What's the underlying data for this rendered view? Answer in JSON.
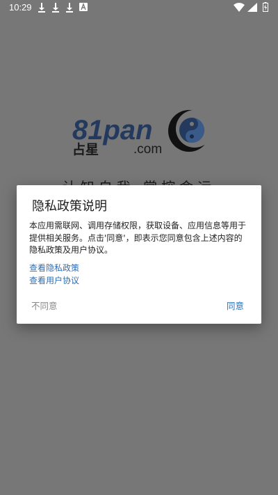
{
  "status_bar": {
    "time": "10:29",
    "left_icons": [
      "download-icon",
      "download-icon",
      "download-icon",
      "app-notification-icon"
    ],
    "right_icons": [
      "wifi-icon",
      "signal-icon",
      "battery-icon"
    ]
  },
  "splash": {
    "logo_main": "81pan",
    "logo_sub_cn": "占星",
    "logo_domain": ".com",
    "tagline": "认知自我 掌控命运"
  },
  "dialog": {
    "title": "隐私政策说明",
    "body": "本应用需联网、调用存储权限，获取设备、应用信息等用于提供相关服务。点击'同意'，即表示您同意包含上述内容的隐私政策及用户协议。",
    "link_privacy": "查看隐私政策",
    "link_user_agreement": "查看用户协议",
    "disagree_label": "不同意",
    "agree_label": "同意"
  },
  "colors": {
    "background": "#777777",
    "accent": "#2f6eb3",
    "logo_blue": "#1d3f7a"
  }
}
